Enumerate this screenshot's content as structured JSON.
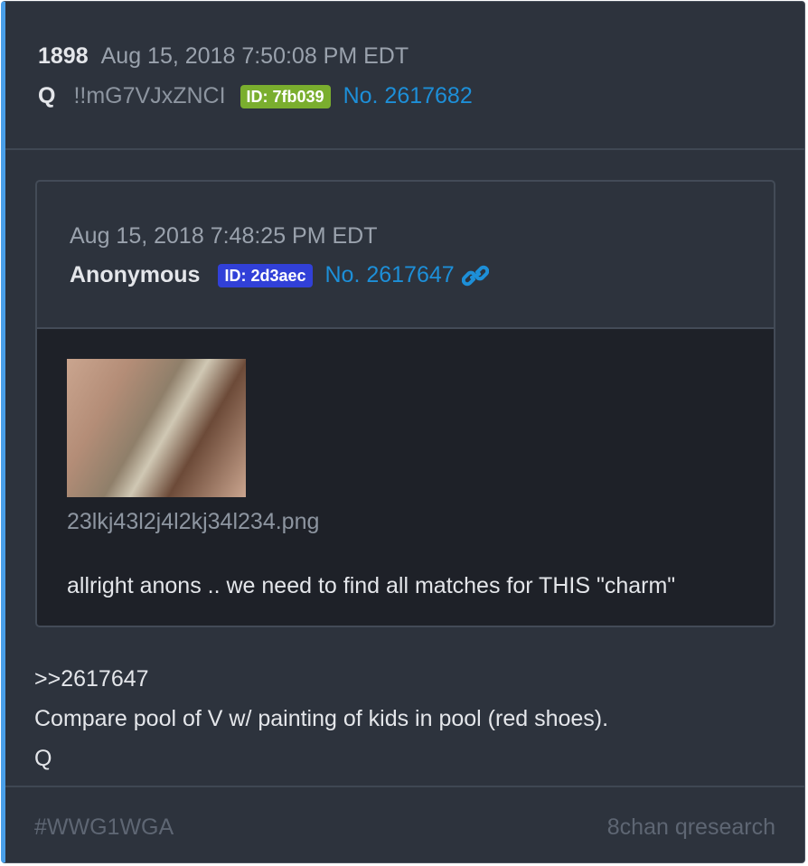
{
  "post": {
    "number": "1898",
    "date": "Aug 15, 2018 7:50:08 PM EDT",
    "author": "Q",
    "tripcode": "!!mG7VJxZNCI",
    "id_label": "ID: 7fb039",
    "post_link": "No. 2617682"
  },
  "quoted": {
    "date": "Aug 15, 2018 7:48:25 PM EDT",
    "author": "Anonymous",
    "id_label": "ID: 2d3aec",
    "post_link": "No. 2617647",
    "link_icon": "link-icon",
    "filename": "23lkj43l2j4l2kj34l234.png",
    "text": "allright anons .. we need to find all matches for THIS \"charm\""
  },
  "body": {
    "lines": [
      ">>2617647",
      "Compare pool of V w/ painting of kids in pool (red shoes).",
      "Q"
    ]
  },
  "footer": {
    "tag": "#WWG1WGA",
    "board": "8chan qresearch"
  },
  "colors": {
    "accent_bar": "#4a9fe8",
    "id_green": "#7aae2e",
    "id_blue": "#3140d8",
    "link": "#1d8fd8"
  }
}
